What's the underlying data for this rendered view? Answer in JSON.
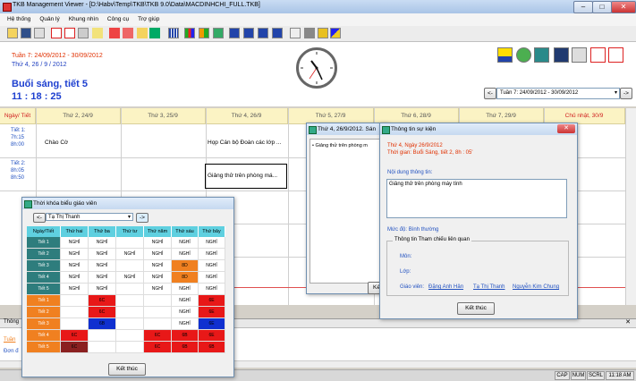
{
  "window": {
    "title": "TKB Management Viewer - [D:\\Habv\\Temp\\TKB\\TKB 9.0\\Data\\MACDINHCHI_FULL.TKB]"
  },
  "menu": [
    "Hệ thống",
    "Quản lý",
    "Khung nhìn",
    "Công cụ",
    "Trợ giúp"
  ],
  "info": {
    "week": "Tuần 7: 24/09/2012 - 30/09/2012",
    "day": "Thứ 4, 26 / 9 / 2012",
    "session": "Buổi sáng, tiết 5",
    "time": "11 : 18 : 25",
    "week_select": "Tuần 7: 24/09/2012 - 30/09/2012"
  },
  "grid": {
    "corner": "Ngày/ Tiết",
    "days": [
      "Thứ 2, 24/9",
      "Thứ 3, 25/9",
      "Thứ 4, 26/9",
      "Thứ 5, 27/9",
      "Thứ 6, 28/9",
      "Thứ 7, 29/9",
      "Chủ nhật, 30/9"
    ],
    "rows": [
      {
        "label": "Tiết 1:",
        "t1": "7h:15",
        "t2": "8h:00"
      },
      {
        "label": "Tiết 2:",
        "t1": "8h:05",
        "t2": "8h:50"
      }
    ],
    "events": {
      "mon_t1": "Chào Cờ",
      "wed_t1": "Họp Cán bộ Đoàn các lớp ...",
      "wed_t2": "Giảng thử trên phòng má..."
    }
  },
  "popup_event_list": {
    "title": "Thứ 4, 26/9/2012. Sán",
    "item": "• Giảng thử trên phòng m"
  },
  "dialog_event": {
    "title": "Thông tin sự kiện",
    "date": "Thứ 4, Ngày 26/9/2012",
    "time": "Thời gian: Buổi Sáng, tiết 2, 8h : 05'",
    "content_label": "Nội dung thông tin:",
    "content": "Giảng thử trên phòng máy tính",
    "level": "Mức độ: Bình thường",
    "group_title": "Thông tin Tham chiếu liên quan",
    "subject_label": "Môn:",
    "class_label": "Lớp:",
    "teacher_label": "Giáo viên:",
    "teachers": [
      "Đặng Anh Hân",
      "Tạ Thị Thanh",
      "Nguyễn Kim Chung"
    ],
    "close": "Kết thúc"
  },
  "dialog_tkb": {
    "title": "Thời khóa biểu giáo viên",
    "prev": "<-",
    "next": "->",
    "teacher": "Tạ Thị Thanh",
    "headers": [
      "Ngày/Tiết",
      "Thứ hai",
      "Thứ ba",
      "Thứ tư",
      "Thứ năm",
      "Thứ sáu",
      "Thứ bảy"
    ],
    "rows": [
      {
        "label": "Tiết 1",
        "cells": [
          "NGHỈ",
          "NGHỈ",
          "",
          "NGHỈ",
          "NGHỈ",
          "NGHỈ"
        ]
      },
      {
        "label": "Tiết 2",
        "cells": [
          "NGHỈ",
          "NGHỈ",
          "NGHỈ",
          "NGHỈ",
          "NGHỈ",
          "NGHỈ"
        ]
      },
      {
        "label": "Tiết 3",
        "cells": [
          "NGHỈ",
          "NGHỈ",
          "",
          "NGHỈ",
          "8D",
          "NGHỈ"
        ]
      },
      {
        "label": "Tiết 4",
        "cells": [
          "NGHỈ",
          "NGHỈ",
          "NGHỈ",
          "NGHỈ",
          "8D",
          "NGHỈ"
        ]
      },
      {
        "label": "Tiết 5",
        "cells": [
          "NGHỈ",
          "NGHỈ",
          "",
          "NGHỈ",
          "NGHỈ",
          "NGHỈ"
        ]
      },
      {
        "label": "Tiết 1",
        "cells": [
          "",
          "6C",
          "",
          "",
          "NGHỈ",
          "6E"
        ]
      },
      {
        "label": "Tiết 2",
        "cells": [
          "",
          "6C",
          "",
          "",
          "NGHỈ",
          "6E"
        ]
      },
      {
        "label": "Tiết 3",
        "cells": [
          "",
          "6B",
          "",
          "",
          "NGHỈ",
          "6E"
        ]
      },
      {
        "label": "Tiết 4",
        "cells": [
          "6C",
          "",
          "",
          "6C",
          "6B",
          "6E"
        ]
      },
      {
        "label": "Tiết 5",
        "cells": [
          "6C",
          "",
          "",
          "6C",
          "6B",
          "6B"
        ]
      }
    ],
    "colors": {
      "morning_label": "#2e7d7d",
      "afternoon_label": "#f08020",
      "red": "#e81818",
      "orange": "#f08020",
      "blue": "#1030d0",
      "dark": "#8a2020"
    },
    "close": "Kết thúc"
  },
  "bottom": {
    "tab": "Thông",
    "l1": "Tuần",
    "l2": "Đơn đ"
  },
  "status": [
    "CAP",
    "NUM",
    "SCRL",
    "11:18 AM"
  ]
}
